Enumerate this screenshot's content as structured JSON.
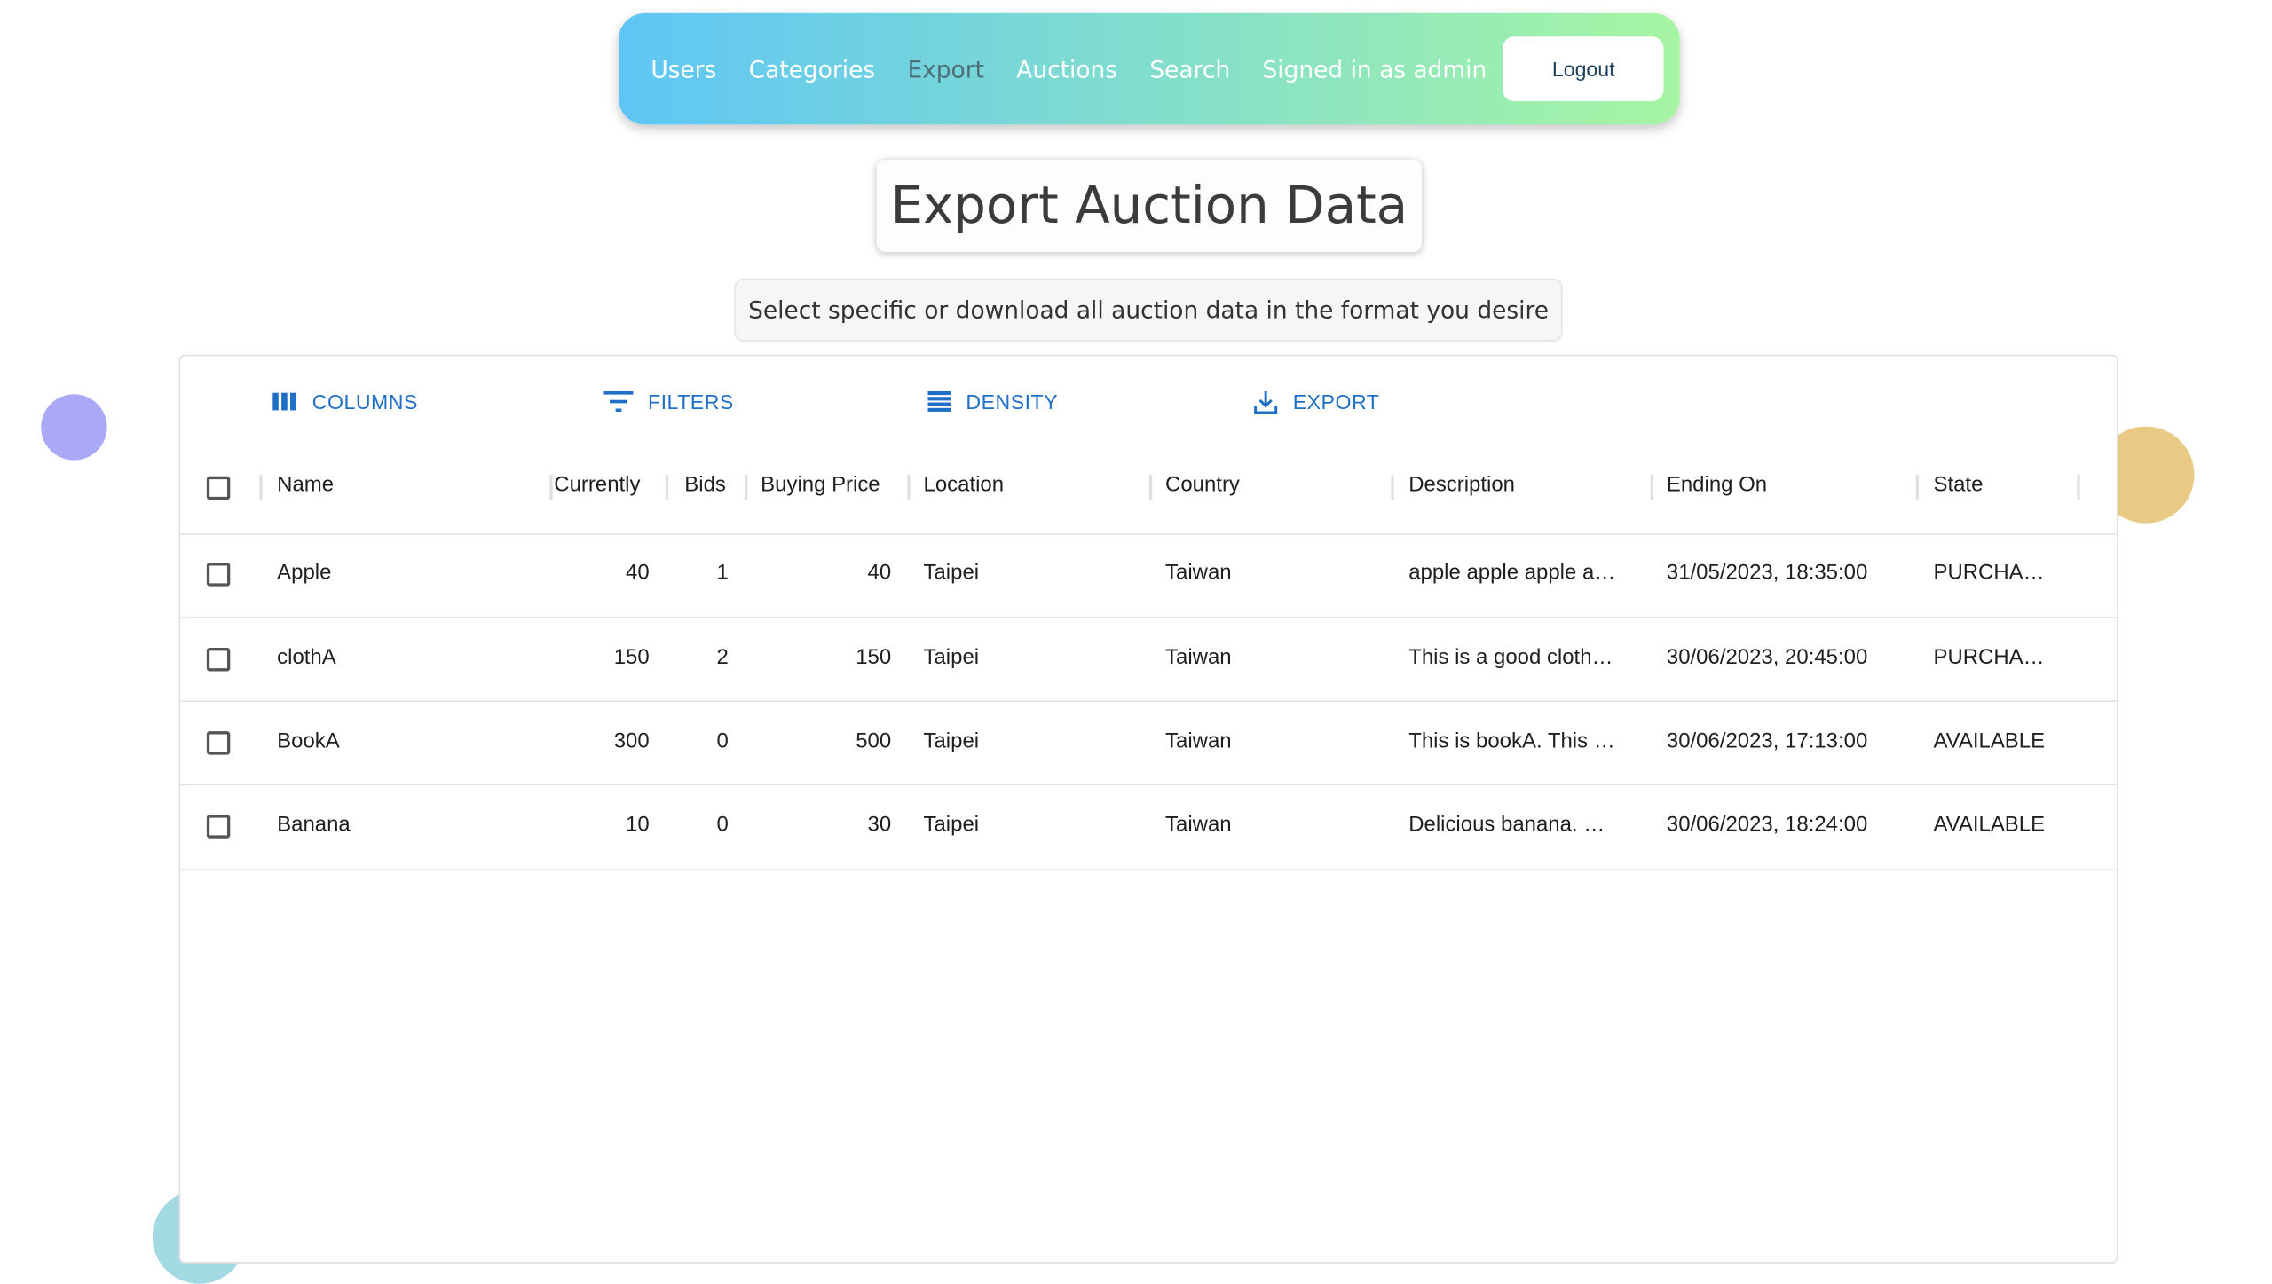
{
  "nav": {
    "links": [
      "Users",
      "Categories",
      "Export",
      "Auctions",
      "Search"
    ],
    "signed_in": "Signed in as admin",
    "logout_label": "Logout",
    "gradient_start": "#5ec6f6",
    "gradient_end": "#a6f5a3"
  },
  "header": {
    "title": "Export Auction Data",
    "subtitle": "Select specific or download all auction data in the format you desire"
  },
  "toolbar": {
    "columns_label": "COLUMNS",
    "filters_label": "FILTERS",
    "density_label": "DENSITY",
    "export_label": "EXPORT",
    "accent": "#1f6fc6"
  },
  "table": {
    "columns": [
      "Name",
      "Currently",
      "Bids",
      "Buying Price",
      "Location",
      "Country",
      "Description",
      "Ending On",
      "State"
    ],
    "rows": [
      {
        "name": "Apple",
        "currently": "40",
        "bids": "1",
        "buying_price": "40",
        "location": "Taipei",
        "country": "Taiwan",
        "description": "apple apple apple a…",
        "ending_on": "31/05/2023, 18:35:00",
        "state": "PURCHA…"
      },
      {
        "name": "clothA",
        "currently": "150",
        "bids": "2",
        "buying_price": "150",
        "location": "Taipei",
        "country": "Taiwan",
        "description": "This is a good cloth…",
        "ending_on": "30/06/2023, 20:45:00",
        "state": "PURCHA…"
      },
      {
        "name": "BookA",
        "currently": "300",
        "bids": "0",
        "buying_price": "500",
        "location": "Taipei",
        "country": "Taiwan",
        "description": "This is bookA. This …",
        "ending_on": "30/06/2023, 17:13:00",
        "state": "AVAILABLE"
      },
      {
        "name": "Banana",
        "currently": "10",
        "bids": "0",
        "buying_price": "30",
        "location": "Taipei",
        "country": "Taiwan",
        "description": "Delicious banana. …",
        "ending_on": "30/06/2023, 18:24:00",
        "state": "AVAILABLE"
      }
    ]
  }
}
